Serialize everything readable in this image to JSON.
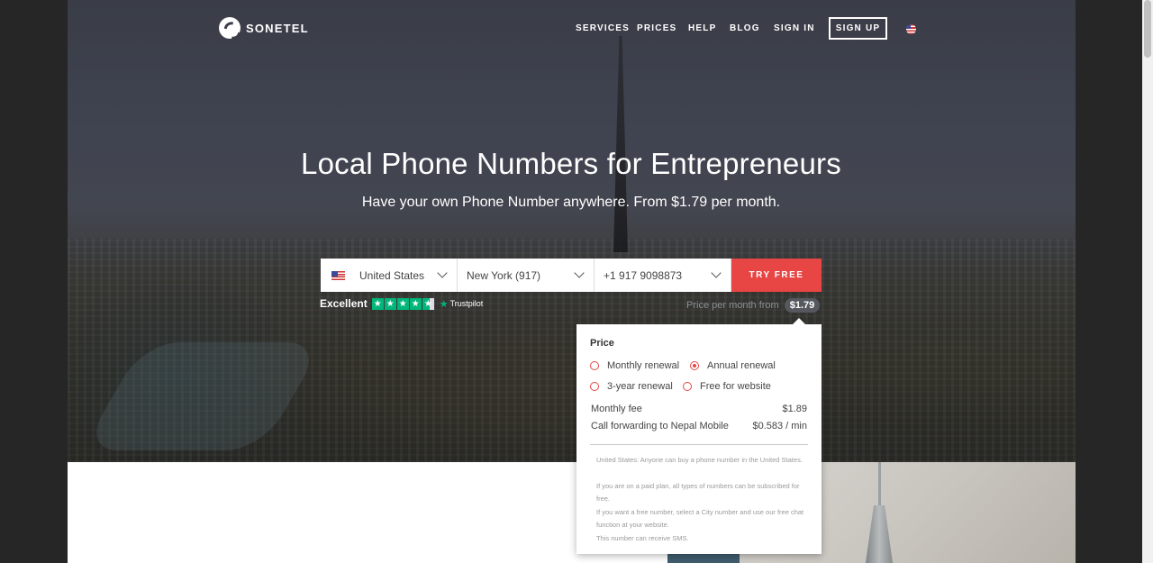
{
  "brand": {
    "name": "SONETEL"
  },
  "nav": {
    "items": [
      {
        "label": "SERVICES"
      },
      {
        "label": "PRICES"
      },
      {
        "label": "HELP"
      },
      {
        "label": "BLOG"
      },
      {
        "label": "SIGN IN"
      }
    ],
    "signup_label": "SIGN UP"
  },
  "hero": {
    "title": "Local Phone Numbers for Entrepreneurs",
    "subtitle": "Have your own Phone Number anywhere. From $1.79 per month."
  },
  "search": {
    "country": "United States",
    "city": "New York (917)",
    "number": "+1 917 9098873",
    "cta": "TRY FREE"
  },
  "trustpilot": {
    "rating_label": "Excellent",
    "stars": 4.5,
    "brand": "Trustpilot"
  },
  "price_from": {
    "label": "Price per month from",
    "value": "$1.79"
  },
  "popover": {
    "title": "Price",
    "options": [
      {
        "label": "Monthly renewal",
        "selected": false
      },
      {
        "label": "Annual renewal",
        "selected": true
      },
      {
        "label": "3-year renewal",
        "selected": false
      },
      {
        "label": "Free for website",
        "selected": false
      }
    ],
    "rows": [
      {
        "label": "Monthly fee",
        "value": "$1.89"
      },
      {
        "label": "Call forwarding to Nepal Mobile",
        "value": "$0.583 / min"
      }
    ],
    "notes": [
      "United States: Anyone can buy a phone number in the United States.",
      "If you are on a paid plan, all types of numbers can be subscribed for free.",
      "If you want a free number, select a City number and use our free chat function at your website.",
      "This number can receive SMS."
    ]
  },
  "colors": {
    "accent": "#e84545",
    "trustpilot": "#00b67a"
  }
}
